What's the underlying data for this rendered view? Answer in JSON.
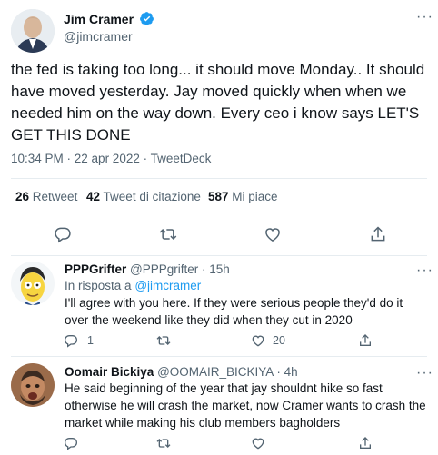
{
  "tweet": {
    "author_name": "Jim Cramer",
    "author_handle": "@jimcramer",
    "text": "the fed is taking too long... it should move Monday.. It should have moved yesterday. Jay moved quickly when when we needed him on the way down. Every ceo i know says LET'S GET THIS DONE",
    "timestamp": "10:34 PM · 22 apr 2022 · TweetDeck",
    "retweets_count": "26",
    "retweets_label": "Retweet",
    "quotes_count": "42",
    "quotes_label": "Tweet di citazione",
    "likes_count": "587",
    "likes_label": "Mi piace"
  },
  "replies": [
    {
      "author_name": "PPPGrifter",
      "author_handle": "@PPPgrifter",
      "time": "· 15h",
      "in_reply_prefix": "In risposta a",
      "in_reply_handle": "@jimcramer",
      "text": "I'll agree with you here. If they were serious people they'd do it over the weekend like they did when they cut in 2020",
      "reply_count": "1",
      "retweet_count": "",
      "like_count": "20"
    },
    {
      "author_name": "Oomair Bickiya",
      "author_handle": "@OOMAIR_BICKIYA",
      "time": "· 4h",
      "text": "He said beginning of the year that jay shouldnt hike so fast otherwise he will crash the market, now Cramer wants to crash the market while making his club members bagholders"
    }
  ],
  "colors": {
    "accent": "#1d9bf0",
    "text": "#0f1419",
    "secondary": "#536471",
    "divider": "#e6ecf0"
  }
}
